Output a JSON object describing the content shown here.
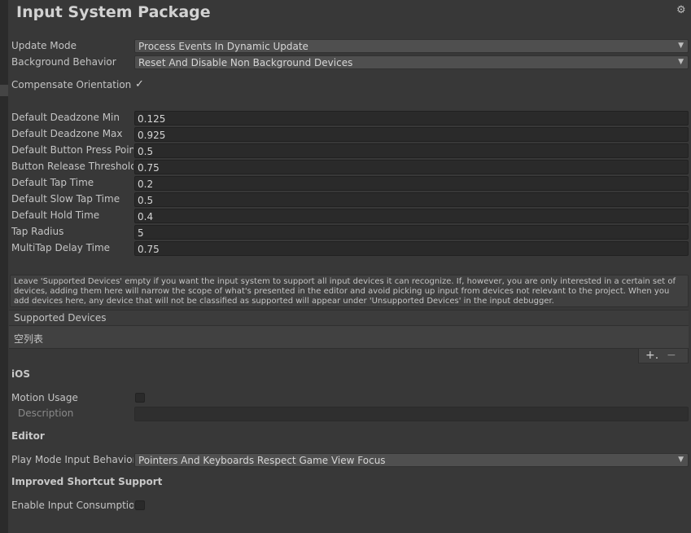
{
  "title": "Input System Package",
  "header": {
    "settings_icon": "gear-icon"
  },
  "update_mode": {
    "label": "Update Mode",
    "value": "Process Events In Dynamic Update"
  },
  "background_behavior": {
    "label": "Background Behavior",
    "value": "Reset And Disable Non Background Devices"
  },
  "compensate_orientation": {
    "label": "Compensate Orientation",
    "checked": true,
    "mark": "✓"
  },
  "fields": [
    {
      "label": "Default Deadzone Min",
      "value": "0.125"
    },
    {
      "label": "Default Deadzone Max",
      "value": "0.925"
    },
    {
      "label": "Default Button Press Point",
      "value": "0.5"
    },
    {
      "label": "Button Release Threshold",
      "value": "0.75"
    },
    {
      "label": "Default Tap Time",
      "value": "0.2"
    },
    {
      "label": "Default Slow Tap Time",
      "value": "0.5"
    },
    {
      "label": "Default Hold Time",
      "value": "0.4"
    },
    {
      "label": "Tap Radius",
      "value": "5"
    },
    {
      "label": "MultiTap Delay Time",
      "value": "0.75"
    }
  ],
  "help_text": "Leave 'Supported Devices' empty if you want the input system to support all input devices it can recognize. If, however, you are only interested in a certain set of devices, adding them here will narrow the scope of what's presented in the editor and avoid picking up input from devices not relevant to the project. When you add devices here, any device that will not be classified as supported will appear under 'Unsupported Devices' in the input debugger.",
  "supported_devices": {
    "header": "Supported Devices",
    "empty_text": "空列表",
    "add_label": "+.",
    "remove_label": "−"
  },
  "ios": {
    "section": "iOS",
    "motion_usage_label": "Motion Usage",
    "motion_usage_checked": false,
    "description_label": "Description",
    "description_value": ""
  },
  "editor": {
    "section": "Editor",
    "play_mode_label": "Play Mode Input Behavior",
    "play_mode_value": "Pointers And Keyboards Respect Game View Focus"
  },
  "shortcut": {
    "section": "Improved Shortcut Support",
    "enable_label": "Enable Input Consumption",
    "enable_checked": false
  },
  "dropdown_arrow": "▼"
}
